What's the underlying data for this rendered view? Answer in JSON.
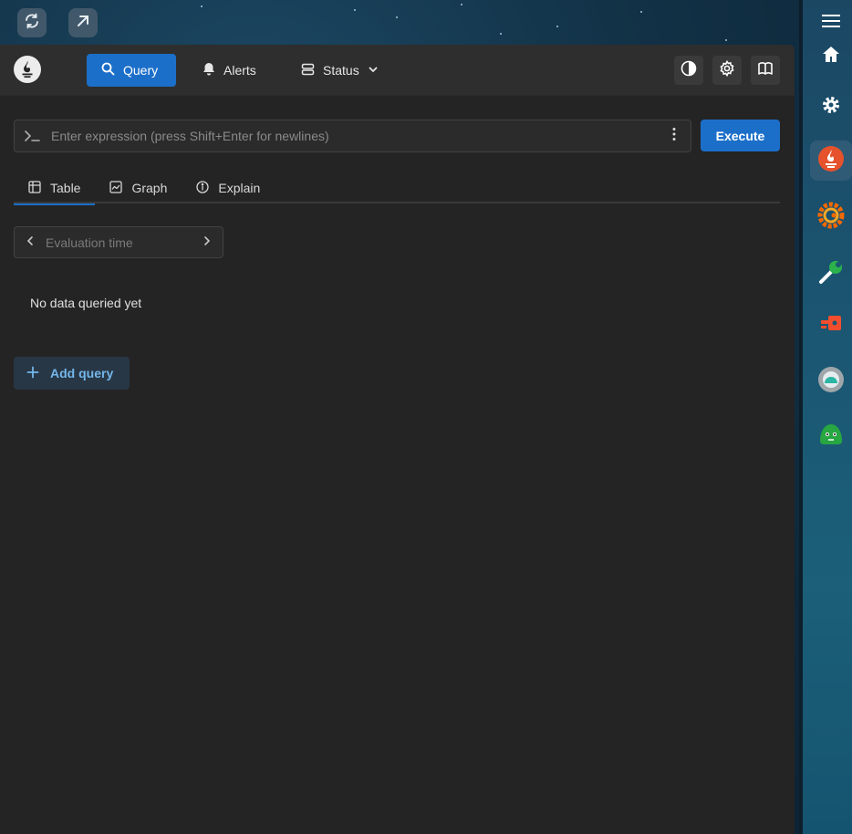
{
  "toolbar": {
    "refresh_icon": "refresh-icon",
    "open_external_icon": "open-external-icon"
  },
  "dock": {
    "items": [
      {
        "name": "menu-icon"
      },
      {
        "name": "home-icon"
      },
      {
        "name": "settings-icon"
      },
      {
        "name": "prometheus-app-icon"
      },
      {
        "name": "grafana-app-icon"
      },
      {
        "name": "wrench-app-icon"
      },
      {
        "name": "plug-app-icon"
      },
      {
        "name": "cloud-app-icon"
      },
      {
        "name": "green-face-app-icon"
      }
    ]
  },
  "nav": {
    "query_label": "Query",
    "alerts_label": "Alerts",
    "status_label": "Status"
  },
  "expression": {
    "placeholder": "Enter expression (press Shift+Enter for newlines)",
    "value": ""
  },
  "execute_label": "Execute",
  "tabs": [
    {
      "label": "Table"
    },
    {
      "label": "Graph"
    },
    {
      "label": "Explain"
    }
  ],
  "evaluation": {
    "placeholder": "Evaluation time"
  },
  "empty_state": "No data queried yet",
  "add_query_label": "Add query",
  "colors": {
    "accent": "#1c6fc9",
    "panel_bg": "#242424",
    "header_bg": "#2e2e2e",
    "add_query_text": "#74b6ea"
  }
}
